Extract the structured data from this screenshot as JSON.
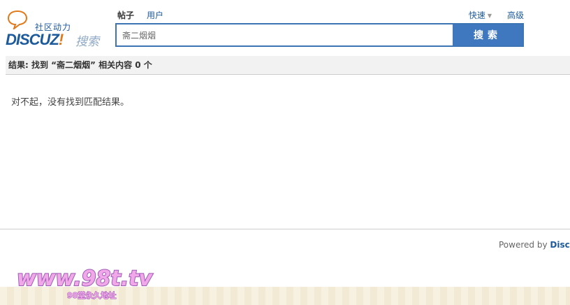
{
  "logo": {
    "tagline": "社区动力",
    "brand": "DISCUZ",
    "brand_mark": "!",
    "search_word": "搜索"
  },
  "search": {
    "tabs": [
      {
        "label": "帖子",
        "active": true
      },
      {
        "label": "用户",
        "active": false
      }
    ],
    "quick_label": "快速",
    "advanced_label": "高级",
    "query": "斋二烟烟",
    "button_label": "搜索"
  },
  "result": {
    "summary": "结果: 找到 “斋二烟烟” 相关内容 0 个",
    "empty_message": "对不起，没有找到匹配结果。"
  },
  "footer": {
    "powered_prefix": "Powered by ",
    "powered_brand": "Discuz"
  },
  "watermark": {
    "main": "www.98t.tv",
    "sub": "98堂永久地址"
  },
  "colors": {
    "accent": "#3f78be",
    "link": "#1c5a9c",
    "brand_orange": "#e07a1b"
  }
}
